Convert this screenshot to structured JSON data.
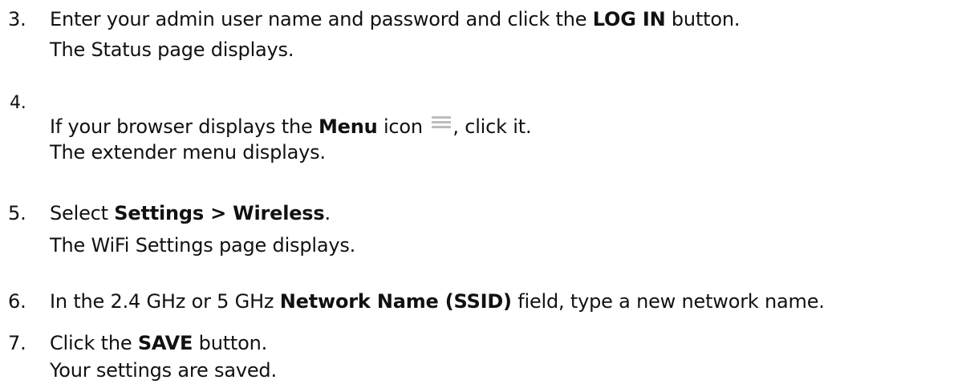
{
  "steps": [
    {
      "number": "3.",
      "line1_pre": "Enter your admin user name and password and click the ",
      "line1_bold": "LOG IN",
      "line1_post": " button.",
      "line2": "The Status page displays."
    },
    {
      "number": "4.",
      "line1_pre": "If your browser displays the ",
      "line1_bold": "Menu",
      "line1_mid": " icon ",
      "line1_post": ", click it.",
      "icon": "hamburger-menu-icon",
      "line2": "The extender menu displays."
    },
    {
      "number": "5.",
      "line1_pre": "Select ",
      "line1_bold": "Settings > Wireless",
      "line1_post": ".",
      "line2": "The WiFi Settings page displays."
    },
    {
      "number": "6.",
      "line1_pre": "In the 2.4 GHz or 5 GHz ",
      "line1_bold": "Network Name (SSID)",
      "line1_post": " field, type a new network name."
    },
    {
      "number": "7.",
      "line1_pre": "Click the ",
      "line1_bold": "SAVE",
      "line1_post": " button.",
      "line2": "Your settings are saved."
    }
  ],
  "colors": {
    "text": "#111111",
    "icon": "#bdbdbd"
  }
}
